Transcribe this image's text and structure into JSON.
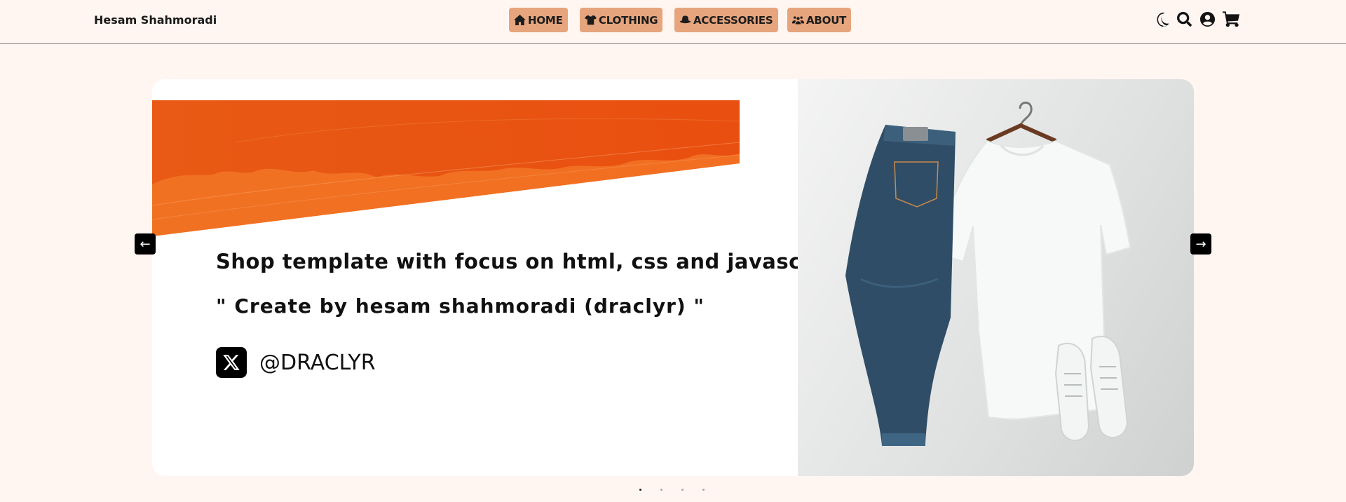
{
  "brand": {
    "name": "Hesam Shahmoradi"
  },
  "nav": {
    "links": [
      {
        "label": "HOME",
        "icon": "house-icon"
      },
      {
        "label": "CLOTHING",
        "icon": "shirt-icon"
      },
      {
        "label": "ACCESSORIES",
        "icon": "hat-icon"
      },
      {
        "label": "ABOUT",
        "icon": "users-icon"
      }
    ],
    "actions": [
      "moon-icon",
      "search-icon",
      "user-circle-icon",
      "cart-icon"
    ]
  },
  "slide": {
    "headline": "Shop template with focus on html, css and javascript.",
    "subline": "\" Create by hesam shahmoradi (draclyr) \"",
    "social_handle": "@DRACLYR",
    "social_icon": "x-logo-icon"
  },
  "slider": {
    "prev_label": "←",
    "next_label": "→",
    "dot_count": 4
  },
  "colors": {
    "background": "#fff5f1",
    "nav_button": "#e6a57c",
    "banner_orange": "#e85313"
  }
}
